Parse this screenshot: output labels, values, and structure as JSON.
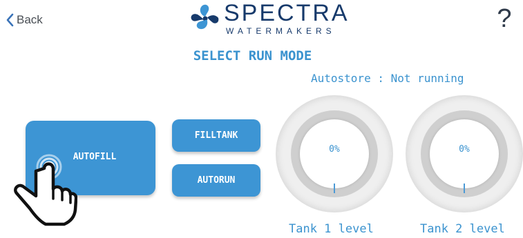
{
  "header": {
    "back_label": "Back",
    "help_label": "?",
    "logo_word": "SPECTRA",
    "logo_sub": "WATERMAKERS"
  },
  "main": {
    "title": "SELECT RUN MODE",
    "autostore_status": "Autostore : Not running",
    "buttons": {
      "autofill": "AUTOFILL",
      "filltank": "FILLTANK",
      "autorun": "AUTORUN"
    },
    "tanks": [
      {
        "value": "0%",
        "label": "Tank 1 level"
      },
      {
        "value": "0%",
        "label": "Tank 2 level"
      }
    ]
  },
  "icons": {
    "back": "chevron-left-icon",
    "logo": "spectra-logo-icon",
    "tap_hint": "hand-pointer-icon"
  },
  "colors": {
    "accent": "#3d95d4",
    "text_accent": "#3b93cf",
    "brand": "#173a6b",
    "gauge_track": "#cfcfcf"
  }
}
